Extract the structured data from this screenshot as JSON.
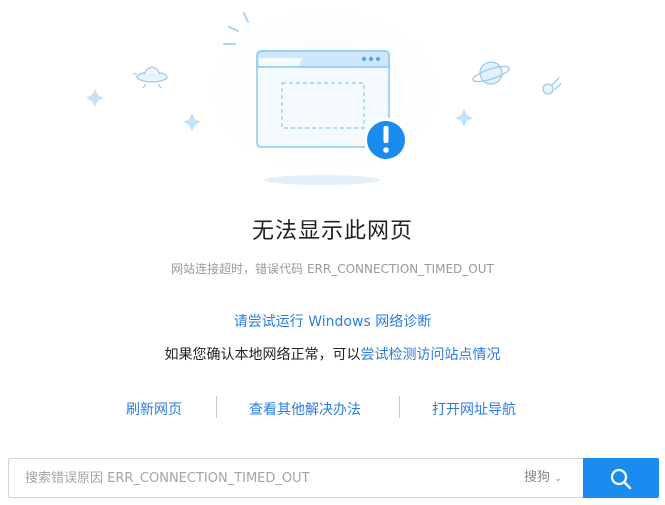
{
  "page": {
    "title": "无法显示此网页",
    "subtitle": "网站连接超时，错误代码 ERR_CONNECTION_TIMED_OUT"
  },
  "suggestions": {
    "diagnose_link": "请尝试运行 Windows 网络诊断",
    "line2_prefix": "如果您确认本地网络正常，可以",
    "line2_link": "尝试检测访问站点情况"
  },
  "actions": [
    {
      "label": "刷新网页"
    },
    {
      "label": "查看其他解决办法"
    },
    {
      "label": "打开网址导航"
    }
  ],
  "search": {
    "placeholder": "搜索错误原因 ERR_CONNECTION_TIMED_OUT",
    "engine": "搜狗"
  },
  "colors": {
    "link": "#2b7de0",
    "search_button": "#1a8cf0",
    "alert": "#1a8cf0"
  },
  "icons": [
    "browser-window-icon",
    "alert-icon",
    "ufo-icon",
    "planet-icon",
    "comet-icon",
    "sparkle-icon",
    "search-icon",
    "chevron-down-icon"
  ]
}
